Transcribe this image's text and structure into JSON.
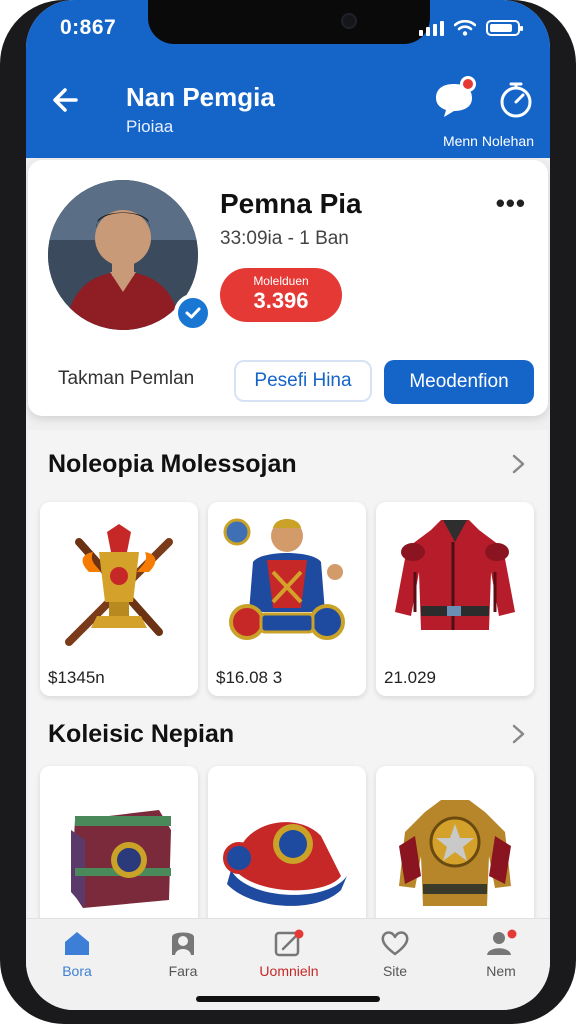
{
  "status": {
    "time": "0:867"
  },
  "header": {
    "title": "Nan Pemgia",
    "subtitle": "Pioiaa",
    "right_label": "Menn Nolehan"
  },
  "profile": {
    "name": "Pemna Pia",
    "meta": "33:09ia - 1 Ban",
    "price_label": "Molelduen",
    "price_value": "3.396",
    "footer_text": "Takman Pemlan",
    "btn_outline": "Pesefi Hina",
    "btn_primary": "Meodenfion"
  },
  "section1": {
    "title": "Noleopia Molessojan",
    "items": [
      {
        "name": "golden-torch-trophy",
        "price": "$1345n"
      },
      {
        "name": "warrior-badge-figure",
        "price": "$16.08 3"
      },
      {
        "name": "red-armor-jacket",
        "price": "21.029"
      }
    ]
  },
  "section2": {
    "title": "Koleisic Nepian",
    "items": [
      {
        "name": "treasure-chest"
      },
      {
        "name": "red-blue-cap"
      },
      {
        "name": "golden-star-armor"
      }
    ]
  },
  "nav": [
    {
      "label": "Bora",
      "icon": "home-icon"
    },
    {
      "label": "Fara",
      "icon": "profile-icon"
    },
    {
      "label": "Uomnieln",
      "icon": "edit-icon"
    },
    {
      "label": "Site",
      "icon": "heart-icon"
    },
    {
      "label": "Nem",
      "icon": "user-icon"
    }
  ],
  "colors": {
    "primary": "#1565c9",
    "accent_red": "#e53935",
    "background": "#efefef"
  }
}
